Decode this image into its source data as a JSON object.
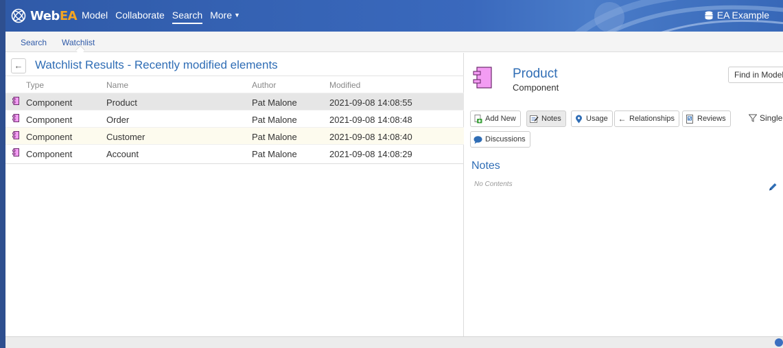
{
  "app": {
    "logo_text_a": "Web",
    "logo_text_b": "EA"
  },
  "nav": {
    "items": [
      {
        "label": "Model"
      },
      {
        "label": "Collaborate"
      },
      {
        "label": "Search"
      },
      {
        "label": "More"
      }
    ],
    "active": "Search"
  },
  "model_selector": {
    "label": "EA Example"
  },
  "subtabs": [
    {
      "label": "Search"
    },
    {
      "label": "Watchlist"
    }
  ],
  "results": {
    "title": "Watchlist Results - Recently modified elements",
    "columns": [
      "Type",
      "Name",
      "Author",
      "Modified"
    ],
    "rows": [
      {
        "type": "Component",
        "name": "Product",
        "author": "Pat Malone",
        "modified": "2021-09-08 14:08:55"
      },
      {
        "type": "Component",
        "name": "Order",
        "author": "Pat Malone",
        "modified": "2021-09-08 14:08:48"
      },
      {
        "type": "Component",
        "name": "Customer",
        "author": "Pat Malone",
        "modified": "2021-09-08 14:08:40"
      },
      {
        "type": "Component",
        "name": "Account",
        "author": "Pat Malone",
        "modified": "2021-09-08 14:08:29"
      }
    ]
  },
  "details": {
    "name": "Product",
    "type": "Component",
    "find_button": "Find in Model",
    "toolbar": {
      "add_new": "Add New",
      "notes": "Notes",
      "usage": "Usage",
      "relationships": "Relationships",
      "reviews": "Reviews",
      "single": "Single",
      "discussions": "Discussions"
    },
    "section_title": "Notes",
    "notes_empty": "No Contents"
  },
  "colors": {
    "nav_bg": "#2f5aa8",
    "accent": "#2f6db5",
    "component_fill": "#f39cf3",
    "logo_accent": "#f4a522"
  }
}
